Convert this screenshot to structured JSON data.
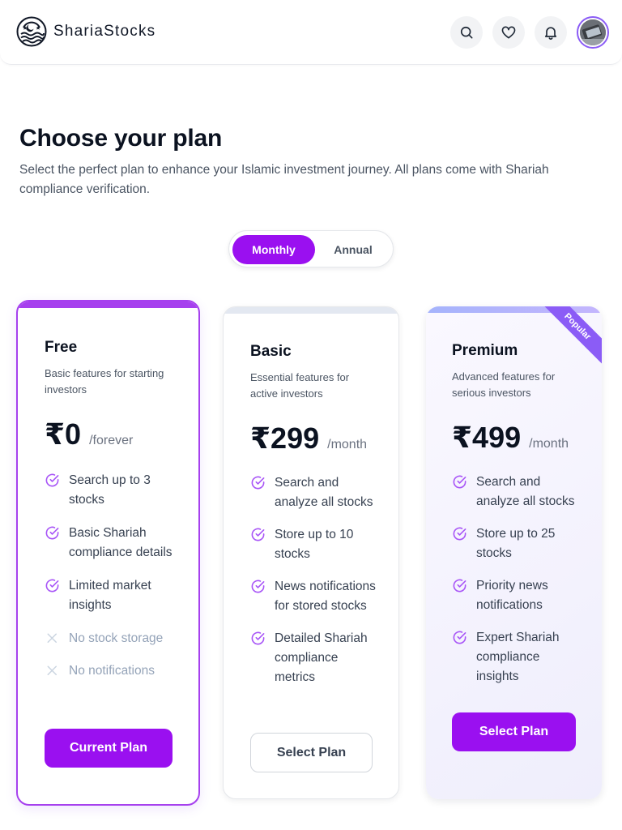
{
  "brand": {
    "name": "ShariaStocks"
  },
  "header": {
    "icons": [
      "search-icon",
      "heart-icon",
      "bell-icon"
    ],
    "avatar": "user-avatar"
  },
  "page": {
    "title": "Choose your plan",
    "subtitle": "Select the perfect plan to enhance your Islamic investment journey. All plans come with Shariah compliance verification."
  },
  "billing_toggle": {
    "options": [
      "Monthly",
      "Annual"
    ],
    "selected": "Monthly"
  },
  "plans": [
    {
      "name": "Free",
      "description": "Basic features for starting investors",
      "price": "₹0",
      "period": "/forever",
      "features": [
        {
          "text": "Search up to 3 stocks",
          "included": true
        },
        {
          "text": "Basic Shariah compliance details",
          "included": true
        },
        {
          "text": "Limited market insights",
          "included": true
        },
        {
          "text": "No stock storage",
          "included": false
        },
        {
          "text": "No notifications",
          "included": false
        }
      ],
      "button": "Current Plan",
      "current": true
    },
    {
      "name": "Basic",
      "description": "Essential features for active investors",
      "price": "₹299",
      "period": "/month",
      "features": [
        {
          "text": "Search and analyze all stocks",
          "included": true
        },
        {
          "text": "Store up to 10 stocks",
          "included": true
        },
        {
          "text": "News notifications for stored stocks",
          "included": true
        },
        {
          "text": "Detailed Shariah compliance metrics",
          "included": true
        }
      ],
      "button": "Select Plan"
    },
    {
      "name": "Premium",
      "badge": "Popular",
      "description": "Advanced features for serious investors",
      "price": "₹499",
      "period": "/month",
      "features": [
        {
          "text": "Search and analyze all stocks",
          "included": true
        },
        {
          "text": "Store up to 25 stocks",
          "included": true
        },
        {
          "text": "Priority news notifications",
          "included": true
        },
        {
          "text": "Expert Shariah compliance insights",
          "included": true
        }
      ],
      "button": "Select Plan"
    }
  ],
  "colors": {
    "accent": "#9a10f0",
    "card_border_active": "#a640ee",
    "ribbon": "#8b5cf6",
    "check": "#a855f7",
    "text_dark": "#0b1220",
    "text_muted": "#4b5563"
  }
}
